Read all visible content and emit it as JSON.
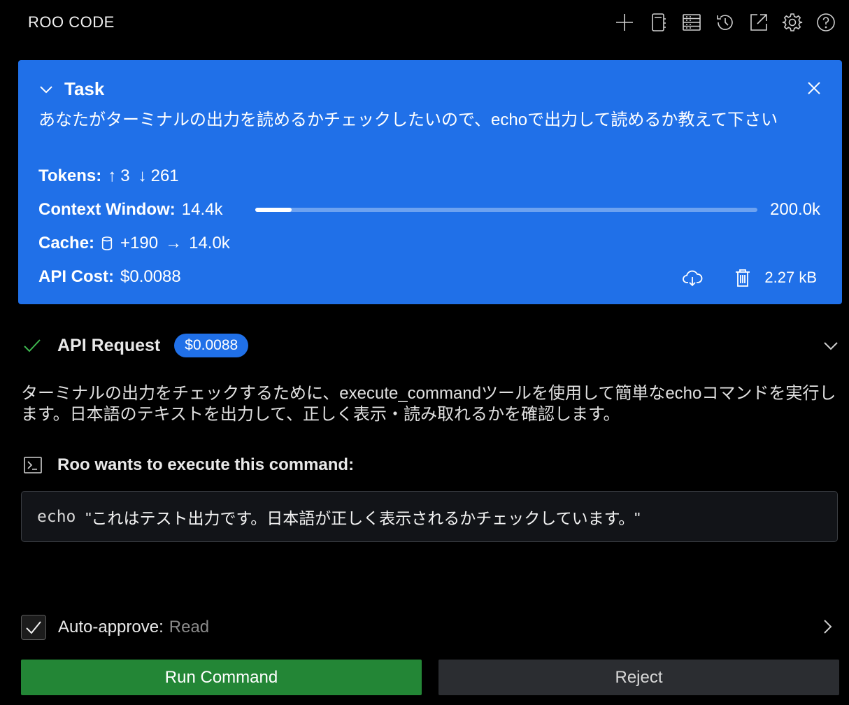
{
  "app": {
    "title": "ROO CODE"
  },
  "toolbar": {
    "icons": [
      "plus-icon",
      "notebook-icon",
      "server-icon",
      "history-icon",
      "external-link-icon",
      "gear-icon",
      "help-icon"
    ]
  },
  "task": {
    "heading": "Task",
    "text": "あなたがターミナルの出力を読めるかチェックしたいので、echoで出力して読めるか教えて下さい",
    "tokens_label": "Tokens:",
    "tokens_up_arrow": "↑",
    "tokens_up": "3",
    "tokens_down_arrow": "↓",
    "tokens_down": "261",
    "context_label": "Context Window:",
    "context_used": "14.4k",
    "context_max": "200.0k",
    "context_fraction": 0.072,
    "cache_label": "Cache:",
    "cache_writes": "+190",
    "cache_arrow": "→",
    "cache_reads": "14.0k",
    "cost_label": "API Cost:",
    "cost_value": "$0.0088",
    "size": "2.27 kB"
  },
  "api_request": {
    "label": "API Request",
    "cost": "$0.0088"
  },
  "message": {
    "text": "ターミナルの出力をチェックするために、execute_commandツールを使用して簡単なechoコマンドを実行します。日本語のテキストを出力して、正しく表示・読み取れるかを確認します。"
  },
  "command": {
    "heading": "Roo wants to execute this command:",
    "name": "echo",
    "argument": "\"これはテスト出力です。日本語が正しく表示されるかチェックしています。\""
  },
  "auto_approve": {
    "label": "Auto-approve:",
    "value": "Read",
    "checked": true
  },
  "buttons": {
    "run": "Run Command",
    "reject": "Reject"
  },
  "colors": {
    "accent": "#2070e8",
    "run": "#238636",
    "success": "#3fb950"
  }
}
